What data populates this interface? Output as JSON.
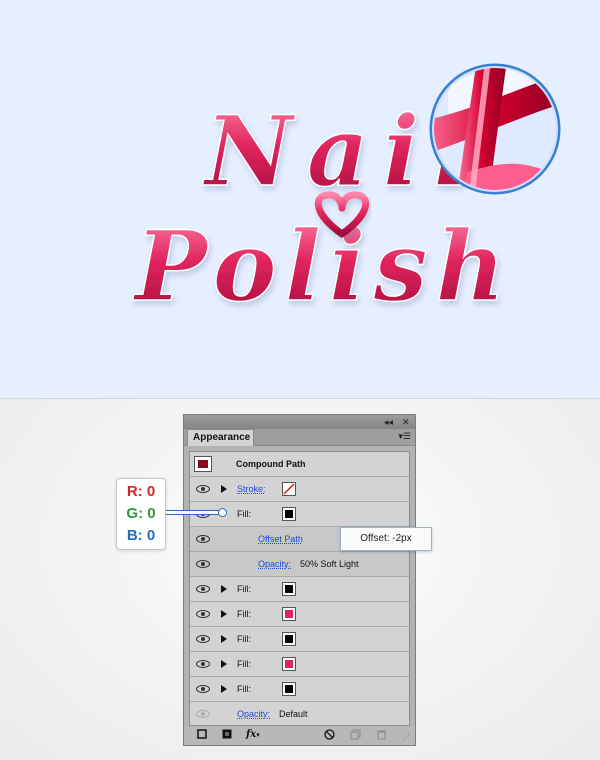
{
  "artwork": {
    "line1": "Nail",
    "line2": "Polish",
    "colors": {
      "background": "#e6efff",
      "pink": "#e0245e",
      "pink_light": "#ff6f9b",
      "pink_dark": "#a80d3c"
    }
  },
  "panel": {
    "tab": "Appearance",
    "object": "Compound Path",
    "rows": [
      {
        "type": "stroke",
        "label": "Stroke:"
      },
      {
        "type": "fill",
        "label": "Fill:",
        "swatch": "#000000"
      },
      {
        "type": "effect",
        "label": "Offset Path"
      },
      {
        "type": "opacity",
        "label": "Opacity:",
        "value": "50% Soft Light"
      },
      {
        "type": "fill",
        "label": "Fill:",
        "swatch": "#000000"
      },
      {
        "type": "fill",
        "label": "Fill:",
        "swatch": "#e0245e"
      },
      {
        "type": "fill",
        "label": "Fill:",
        "swatch": "#000000"
      },
      {
        "type": "fill",
        "label": "Fill:",
        "swatch": "#e0245e"
      },
      {
        "type": "fill",
        "label": "Fill:",
        "swatch": "#000000"
      },
      {
        "type": "opacity",
        "label": "Opacity:",
        "value": "Default"
      }
    ],
    "bottom_icons": [
      "new-stroke-icon",
      "new-fill-icon",
      "fx-icon",
      "clear-icon",
      "duplicate-icon",
      "delete-icon"
    ]
  },
  "tooltip": {
    "text": "Offset: -2px"
  },
  "rgb": {
    "r": "R: 0",
    "g": "G: 0",
    "b": "B: 0",
    "r_color": "#d62828",
    "g_color": "#2e9a3a",
    "b_color": "#1f6fc2"
  }
}
